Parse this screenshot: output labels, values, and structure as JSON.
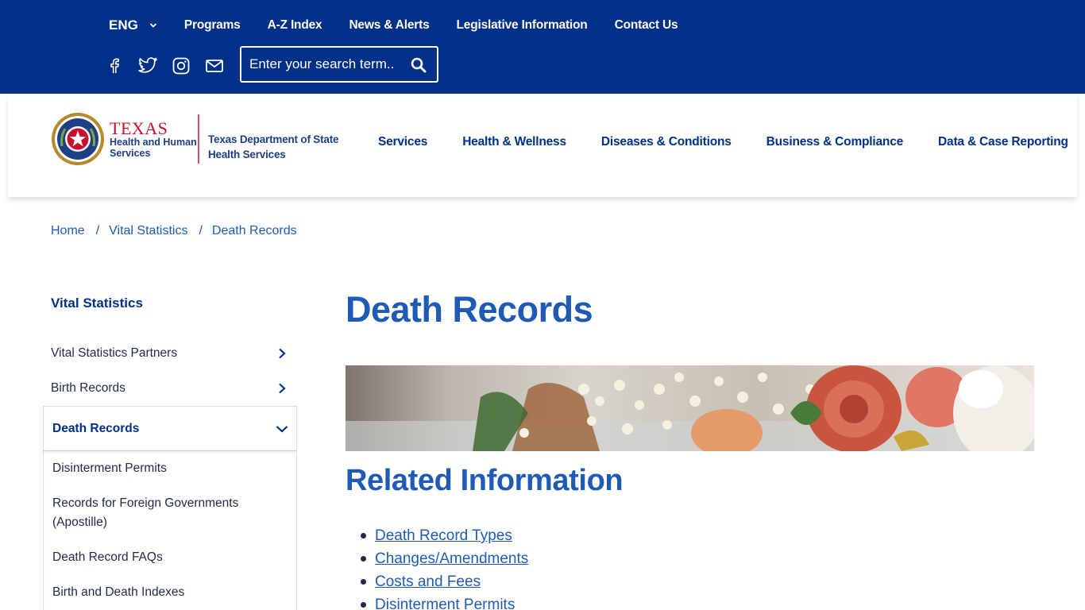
{
  "topbar": {
    "language": "ENG",
    "links": [
      "Programs",
      "A-Z Index",
      "News & Alerts",
      "Legislative Information",
      "Contact Us"
    ],
    "social_icons": [
      "facebook-icon",
      "twitter-icon",
      "instagram-icon",
      "email-icon"
    ],
    "search_placeholder": "Enter your search term..",
    "bg_color": "#003087"
  },
  "logo": {
    "hhs_line1": "TEXAS",
    "hhs_line2": "Health and Human",
    "hhs_line3": "Services",
    "dshs_line1": "Texas Department of State",
    "dshs_line2": "Health Services"
  },
  "mainnav": [
    "Services",
    "Health & Wellness",
    "Diseases & Conditions",
    "Business & Compliance",
    "Data & Case Reporting"
  ],
  "breadcrumb": {
    "items": [
      "Home",
      "Vital Statistics",
      "Death Records"
    ],
    "separator": "/"
  },
  "sidebar": {
    "title": "Vital Statistics",
    "items": [
      "Vital Statistics Partners",
      "Birth Records"
    ],
    "active": "Death Records",
    "subitems": [
      "Disinterment Permits",
      "Records for Foreign Governments (Apostille)",
      "Death Record FAQs",
      "Birth and Death Indexes"
    ]
  },
  "main": {
    "title": "Death Records",
    "section_title": "Related Information",
    "related_links": [
      "Death Record Types",
      "Changes/Amendments",
      "Costs and Fees",
      "Disinterment Permits"
    ]
  },
  "colors": {
    "primary": "#003087",
    "link": "#1f5bb5",
    "accent_red": "#c8102e"
  }
}
